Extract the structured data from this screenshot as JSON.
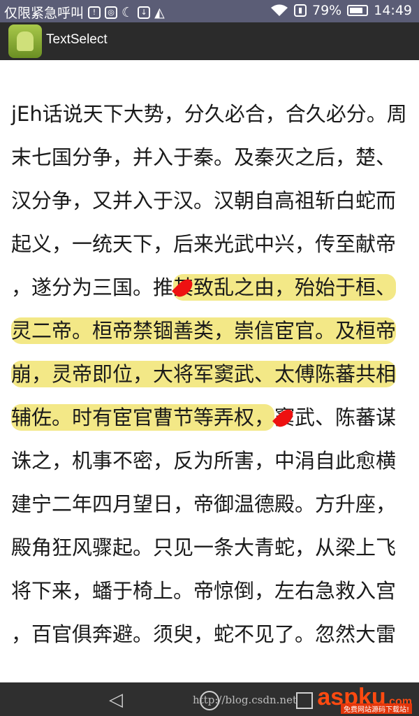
{
  "status_bar": {
    "carrier_text": "仅限紧急呼叫",
    "battery_text": "79%",
    "time": "14:49"
  },
  "action_bar": {
    "title": "TextSelect",
    "icon": "android-icon"
  },
  "content": {
    "lines": [
      "jEh话说天下大势，分久必合，合久必分。周",
      "末七国分争，并入于秦。及秦灭之后，楚、",
      "汉分争，又并入于汉。汉朝自高祖斩白蛇而",
      "起义，一统天下，后来光武中兴，传至献帝",
      "，遂分为三国。推其致乱之由，殆始于桓、",
      "灵二帝。桓帝禁锢善类，崇信宦官。及桓帝",
      "崩，灵帝即位，大将军窦武、太傅陈蕃共相",
      "辅佐。时有宦官曹节等弄权，窦武、陈蕃谋",
      "诛之，机事不密，反为所害，中涓自此愈横",
      "建宁二年四月望日，帝御温德殿。方升座，",
      "殿角狂风骤起。只见一条大青蛇，从梁上飞",
      "将下来，蟠于椅上。帝惊倒，左右急救入宫",
      "，百官俱奔避。须臾，蛇不见了。忽然大雷"
    ],
    "highlight_color": "#f3e887",
    "handle_color": "#ee1111"
  },
  "watermark": {
    "url": "http://blog.csdn.net",
    "logo": "aspku",
    "logo_suffix": ".com",
    "sub": "免费网站源码下载站!"
  }
}
